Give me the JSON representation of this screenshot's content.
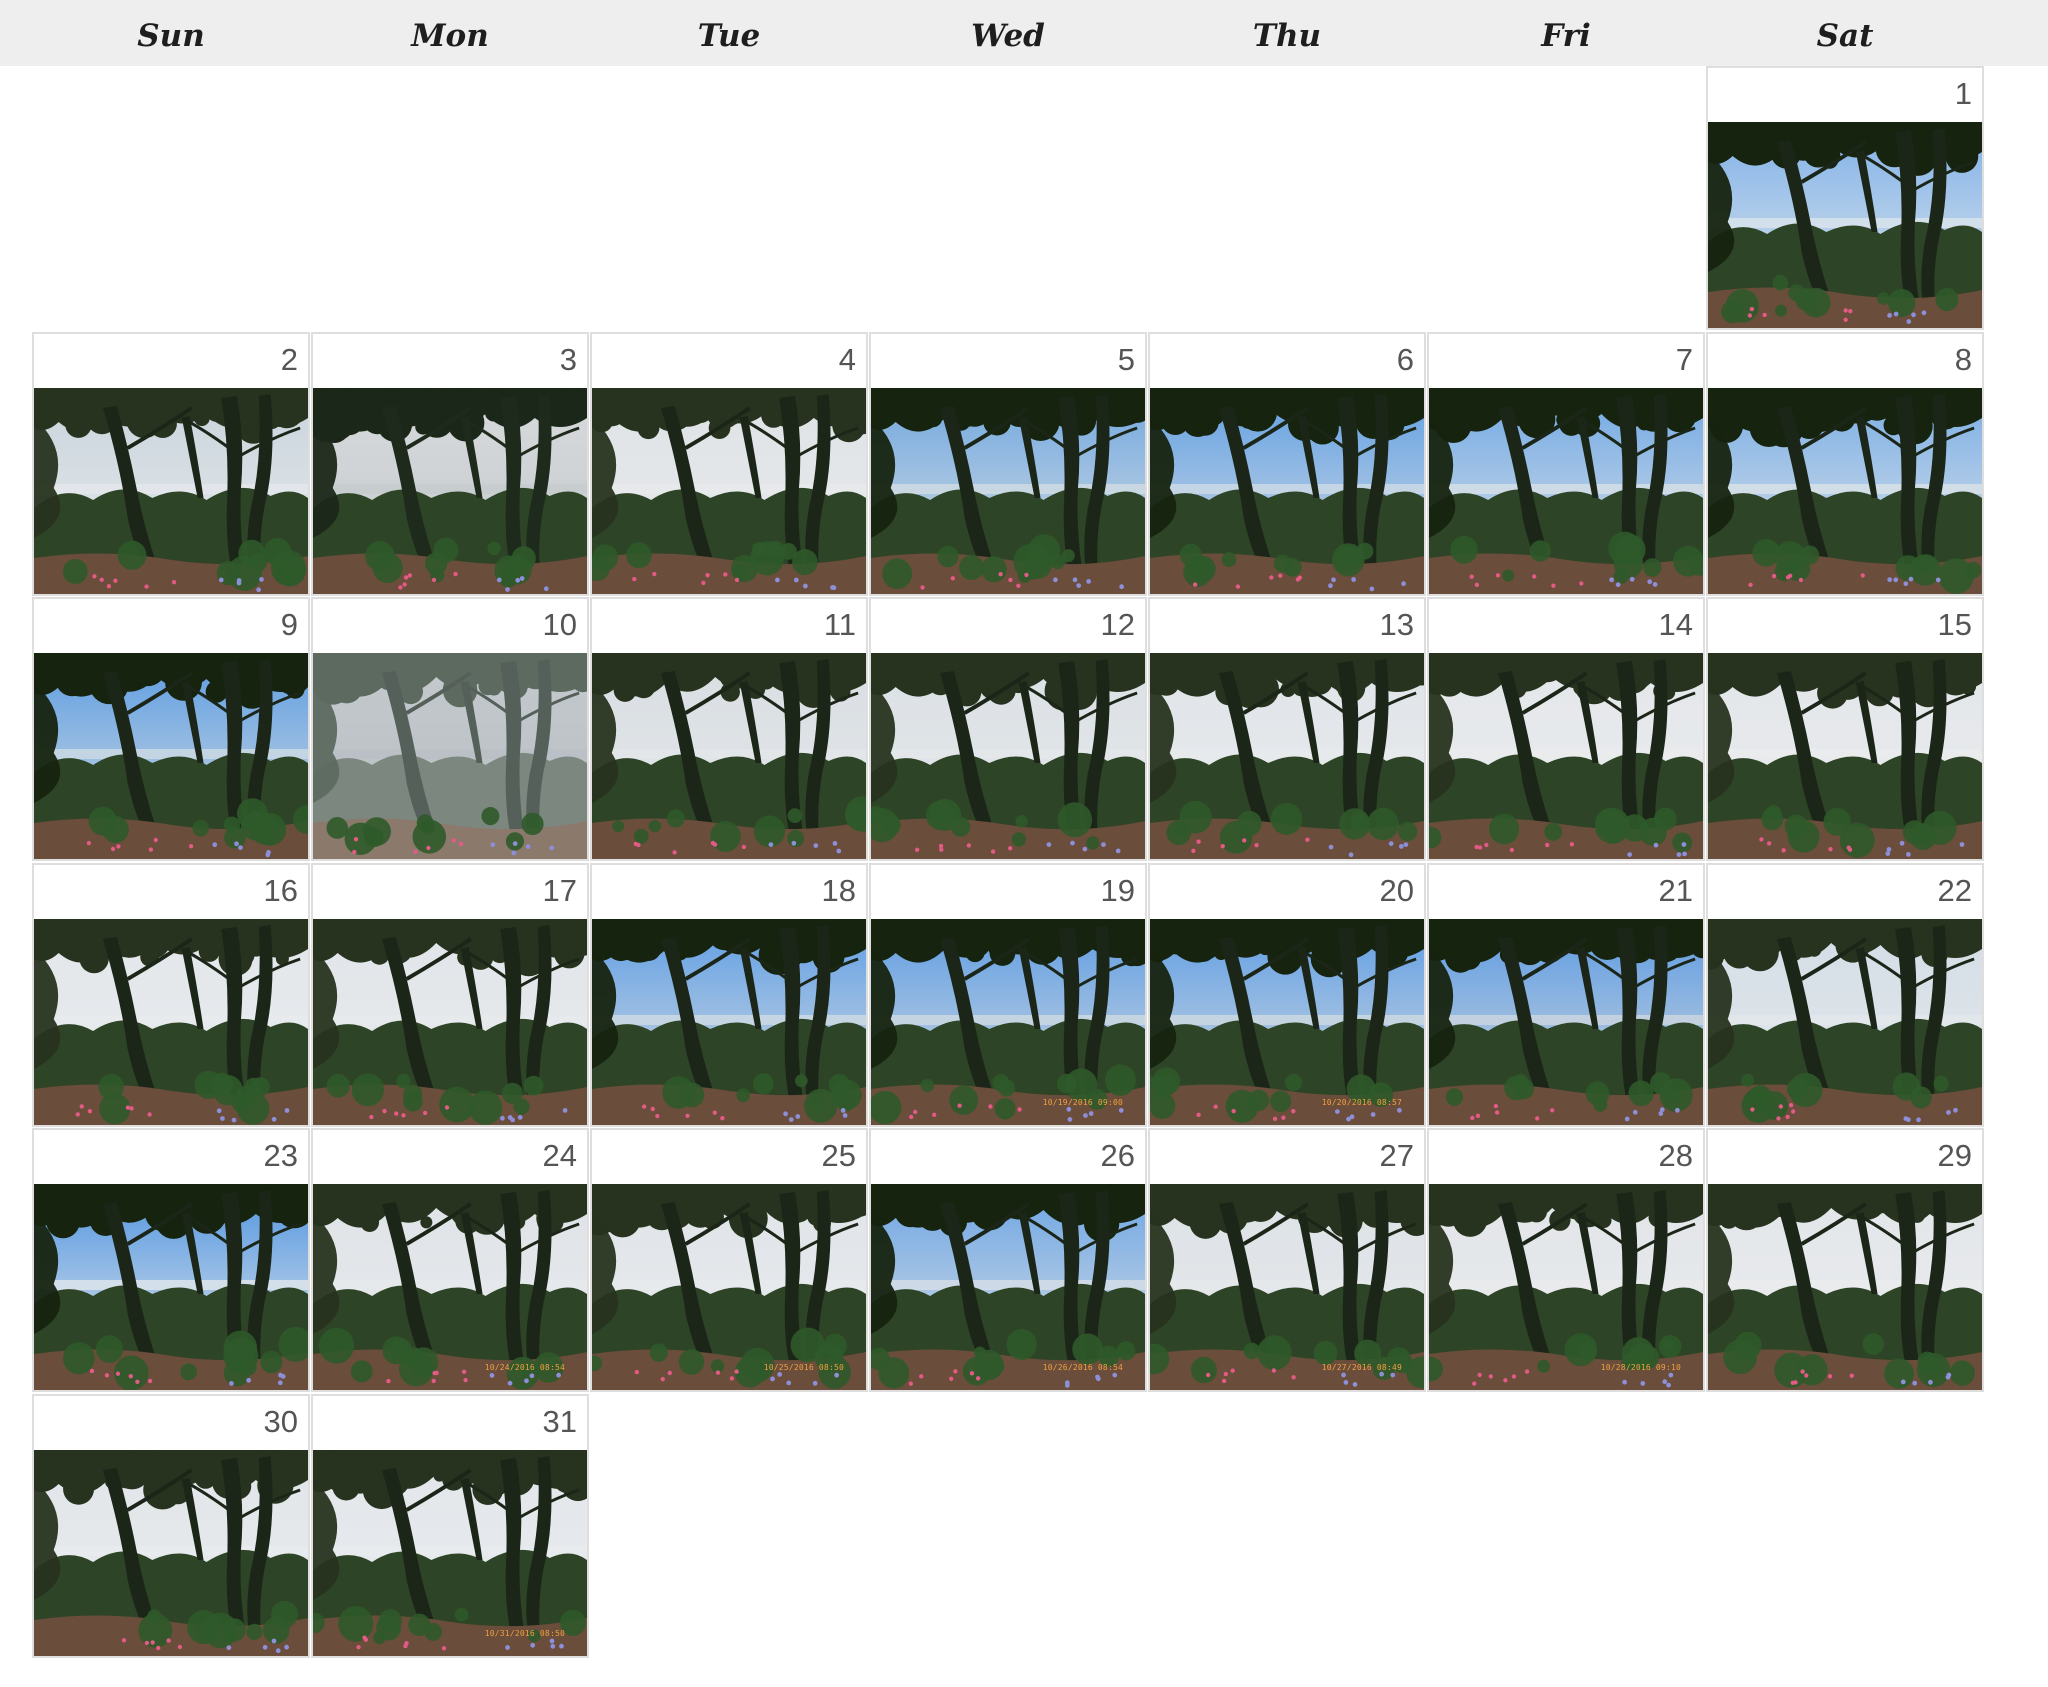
{
  "weekdays": [
    "Sun",
    "Mon",
    "Tue",
    "Wed",
    "Thu",
    "Fri",
    "Sat"
  ],
  "first_weekday_index": 6,
  "days": [
    {
      "day": "1",
      "sky": "#7fb0e8",
      "haze": "#d6e2ec",
      "mood": "bright",
      "stamp": ""
    },
    {
      "day": "2",
      "sky": "#c9d4dc",
      "haze": "#e3e7ea",
      "mood": "light",
      "stamp": ""
    },
    {
      "day": "3",
      "sky": "#d8dadc",
      "haze": "#c7ccce",
      "mood": "dark",
      "stamp": ""
    },
    {
      "day": "4",
      "sky": "#dfe3e6",
      "haze": "#e7e9eb",
      "mood": "light",
      "stamp": ""
    },
    {
      "day": "5",
      "sky": "#6fa6e0",
      "haze": "#cdd9e2",
      "mood": "bright",
      "stamp": ""
    },
    {
      "day": "6",
      "sky": "#5f9ee3",
      "haze": "#c9d7e4",
      "mood": "bright",
      "stamp": ""
    },
    {
      "day": "7",
      "sky": "#6ea7e5",
      "haze": "#d2dde6",
      "mood": "bright",
      "stamp": ""
    },
    {
      "day": "8",
      "sky": "#78ace6",
      "haze": "#d5e0e8",
      "mood": "bright",
      "stamp": ""
    },
    {
      "day": "9",
      "sky": "#5a9be2",
      "haze": "#c8d6e2",
      "mood": "bright",
      "stamp": ""
    },
    {
      "day": "10",
      "sky": "#c4c9cd",
      "haze": "#b9c0c4",
      "mood": "fog",
      "stamp": ""
    },
    {
      "day": "11",
      "sky": "#d9dee2",
      "haze": "#e2e6e9",
      "mood": "light",
      "stamp": ""
    },
    {
      "day": "12",
      "sky": "#dbe0e4",
      "haze": "#e3e7ea",
      "mood": "light",
      "stamp": ""
    },
    {
      "day": "13",
      "sky": "#e0e4e8",
      "haze": "#e7eaed",
      "mood": "light",
      "stamp": ""
    },
    {
      "day": "14",
      "sky": "#e4e7ea",
      "haze": "#e9ebed",
      "mood": "light",
      "stamp": ""
    },
    {
      "day": "15",
      "sky": "#e3e6e9",
      "haze": "#e9ebed",
      "mood": "light",
      "stamp": ""
    },
    {
      "day": "16",
      "sky": "#e2e6ea",
      "haze": "#e8ebed",
      "mood": "light",
      "stamp": ""
    },
    {
      "day": "17",
      "sky": "#e1e5e9",
      "haze": "#e7eaec",
      "mood": "light",
      "stamp": ""
    },
    {
      "day": "18",
      "sky": "#5e9de4",
      "haze": "#cbd7e2",
      "mood": "bright",
      "stamp": ""
    },
    {
      "day": "19",
      "sky": "#5c9be3",
      "haze": "#cad6e1",
      "mood": "bright",
      "stamp": "10/19/2016 09:00"
    },
    {
      "day": "20",
      "sky": "#5d9ce4",
      "haze": "#cad6e1",
      "mood": "bright",
      "stamp": "10/20/2016 08:57"
    },
    {
      "day": "21",
      "sky": "#5a99e2",
      "haze": "#c6d3df",
      "mood": "bright",
      "stamp": ""
    },
    {
      "day": "22",
      "sky": "#d3dde6",
      "haze": "#e2e7eb",
      "mood": "light",
      "stamp": ""
    },
    {
      "day": "23",
      "sky": "#4e93e0",
      "haze": "#d9e2ea",
      "mood": "bright",
      "stamp": ""
    },
    {
      "day": "24",
      "sky": "#dfe3e7",
      "haze": "#e6e9ec",
      "mood": "light",
      "stamp": "10/24/2016 08:54"
    },
    {
      "day": "25",
      "sky": "#e0e4e8",
      "haze": "#e7eaed",
      "mood": "light",
      "stamp": "10/25/2016 08:50"
    },
    {
      "day": "26",
      "sky": "#6aa3e3",
      "haze": "#d1dce6",
      "mood": "bright",
      "stamp": "10/26/2016 08:54"
    },
    {
      "day": "27",
      "sky": "#dde2e6",
      "haze": "#e5e8eb",
      "mood": "light",
      "stamp": "10/27/2016 08:49"
    },
    {
      "day": "28",
      "sky": "#e2e5e8",
      "haze": "#e8eaec",
      "mood": "light",
      "stamp": "10/28/2016 09:10"
    },
    {
      "day": "29",
      "sky": "#e3e6e9",
      "haze": "#e9ebed",
      "mood": "light",
      "stamp": ""
    },
    {
      "day": "30",
      "sky": "#e1e5e9",
      "haze": "#e8ebed",
      "mood": "light",
      "stamp": ""
    },
    {
      "day": "31",
      "sky": "#e2e6ea",
      "haze": "#e8ebee",
      "mood": "light",
      "stamp": "10/31/2016 08:50"
    }
  ],
  "colors": {
    "header_bg": "#eeeeee",
    "cell_border": "#dedede",
    "day_number": "#555555",
    "weekday_text": "#1e1e1e",
    "stamp_text": "#f0a040"
  }
}
